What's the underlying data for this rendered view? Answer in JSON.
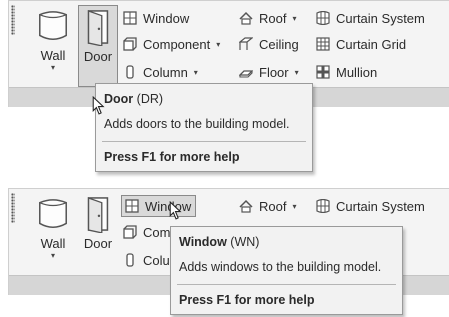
{
  "panel1": {
    "big_buttons": [
      {
        "label": "Wall",
        "has_dropdown": true,
        "icon": "wall-icon"
      },
      {
        "label": "Door",
        "has_dropdown": false,
        "icon": "door-icon"
      }
    ],
    "col1": [
      {
        "label": "Window",
        "icon": "window-icon",
        "dropdown": ""
      },
      {
        "label": "Component",
        "icon": "component-icon",
        "dropdown": "▾"
      },
      {
        "label": "Column",
        "icon": "column-icon",
        "dropdown": "▾"
      }
    ],
    "col2": [
      {
        "label": "Roof",
        "icon": "roof-icon",
        "dropdown": "▾"
      },
      {
        "label": "Ceiling",
        "icon": "ceiling-icon",
        "dropdown": ""
      },
      {
        "label": "Floor",
        "icon": "floor-icon",
        "dropdown": "▾"
      }
    ],
    "col3": [
      {
        "label": "Curtain System",
        "icon": "curtain-system-icon"
      },
      {
        "label": "Curtain Grid",
        "icon": "curtain-grid-icon"
      },
      {
        "label": "Mullion",
        "icon": "mullion-icon"
      }
    ],
    "tooltip": {
      "title": "Door",
      "shortcut": "(DR)",
      "description": "Adds doors to the building model.",
      "help": "Press F1 for more help"
    }
  },
  "panel2": {
    "big_buttons": [
      {
        "label": "Wall",
        "has_dropdown": true,
        "icon": "wall-icon"
      },
      {
        "label": "Door",
        "has_dropdown": false,
        "icon": "door-icon"
      }
    ],
    "col1": [
      {
        "label": "Window",
        "icon": "window-icon"
      },
      {
        "label": "Com",
        "icon": "component-icon"
      },
      {
        "label": "Colu",
        "icon": "column-icon"
      }
    ],
    "col2": [
      {
        "label": "Roof",
        "icon": "roof-icon",
        "dropdown": "▾"
      }
    ],
    "col3": [
      {
        "label": "Curtain System",
        "icon": "curtain-system-icon"
      }
    ],
    "tooltip": {
      "title": "Window",
      "shortcut": "(WN)",
      "description": "Adds windows to the building model.",
      "help": "Press F1 for more help"
    }
  },
  "dropdown_glyph": "▾",
  "colors": {
    "panel_bg": "#f4f4f4",
    "footer_bg": "#d6d6d6",
    "highlight_bg": "#d9d9d9",
    "tooltip_bg": "#f2f2f2"
  }
}
